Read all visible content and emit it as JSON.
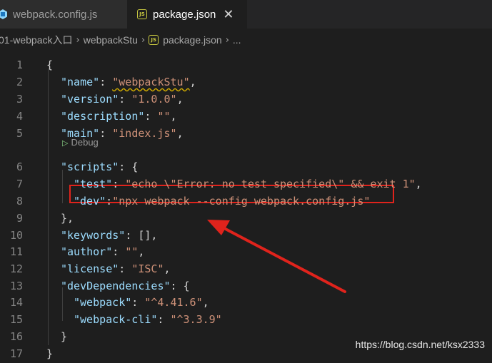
{
  "tabs": [
    {
      "label": "webpack.config.js",
      "icon": "webpack-icon",
      "active": false
    },
    {
      "label": "package.json",
      "icon": "js-icon",
      "active": true,
      "close": "✕"
    }
  ],
  "breadcrumb": {
    "items": [
      "01-webpack入口",
      "webpackStu",
      "package.json",
      "..."
    ],
    "separator": "›"
  },
  "editor": {
    "line_numbers": [
      "1",
      "2",
      "3",
      "4",
      "5",
      "6",
      "7",
      "8",
      "9",
      "10",
      "11",
      "12",
      "13",
      "14",
      "15",
      "16",
      "17"
    ],
    "codelens": {
      "icon": "▷",
      "label": "Debug"
    },
    "lines": [
      [
        {
          "t": "{",
          "c": "punc"
        }
      ],
      [
        {
          "t": "\"name\"",
          "c": "key"
        },
        {
          "t": ": ",
          "c": "punc"
        },
        {
          "t": "\"webpackStu\"",
          "c": "str",
          "squiggle": true
        },
        {
          "t": ",",
          "c": "punc"
        }
      ],
      [
        {
          "t": "\"version\"",
          "c": "key"
        },
        {
          "t": ": ",
          "c": "punc"
        },
        {
          "t": "\"1.0.0\"",
          "c": "str"
        },
        {
          "t": ",",
          "c": "punc"
        }
      ],
      [
        {
          "t": "\"description\"",
          "c": "key"
        },
        {
          "t": ": ",
          "c": "punc"
        },
        {
          "t": "\"\"",
          "c": "str"
        },
        {
          "t": ",",
          "c": "punc"
        }
      ],
      [
        {
          "t": "\"main\"",
          "c": "key"
        },
        {
          "t": ": ",
          "c": "punc"
        },
        {
          "t": "\"index.js\"",
          "c": "str"
        },
        {
          "t": ",",
          "c": "punc"
        }
      ],
      [
        {
          "t": "\"scripts\"",
          "c": "key"
        },
        {
          "t": ": {",
          "c": "punc"
        }
      ],
      [
        {
          "t": "\"test\"",
          "c": "key"
        },
        {
          "t": ": ",
          "c": "punc"
        },
        {
          "t": "\"echo \\\"Error: no test specified\\\" && exit 1\"",
          "c": "str"
        },
        {
          "t": ",",
          "c": "punc"
        }
      ],
      [
        {
          "t": "\"dev\"",
          "c": "key"
        },
        {
          "t": ":",
          "c": "punc"
        },
        {
          "t": "\"npx webpack --config webpack.config.js\"",
          "c": "str"
        }
      ],
      [
        {
          "t": "},",
          "c": "punc"
        }
      ],
      [
        {
          "t": "\"keywords\"",
          "c": "key"
        },
        {
          "t": ": [],",
          "c": "punc"
        }
      ],
      [
        {
          "t": "\"author\"",
          "c": "key"
        },
        {
          "t": ": ",
          "c": "punc"
        },
        {
          "t": "\"\"",
          "c": "str"
        },
        {
          "t": ",",
          "c": "punc"
        }
      ],
      [
        {
          "t": "\"license\"",
          "c": "key"
        },
        {
          "t": ": ",
          "c": "punc"
        },
        {
          "t": "\"ISC\"",
          "c": "str"
        },
        {
          "t": ",",
          "c": "punc"
        }
      ],
      [
        {
          "t": "\"devDependencies\"",
          "c": "key"
        },
        {
          "t": ": {",
          "c": "punc"
        }
      ],
      [
        {
          "t": "\"webpack\"",
          "c": "key"
        },
        {
          "t": ": ",
          "c": "punc"
        },
        {
          "t": "\"^4.41.6\"",
          "c": "str"
        },
        {
          "t": ",",
          "c": "punc"
        }
      ],
      [
        {
          "t": "\"webpack-cli\"",
          "c": "key"
        },
        {
          "t": ": ",
          "c": "punc"
        },
        {
          "t": "\"^3.3.9\"",
          "c": "str"
        }
      ],
      [
        {
          "t": "}",
          "c": "punc"
        }
      ],
      [
        {
          "t": "}",
          "c": "punc"
        }
      ]
    ]
  },
  "annotation": {
    "color": "#e0231c"
  },
  "watermark": "https://blog.csdn.net/ksx2333"
}
